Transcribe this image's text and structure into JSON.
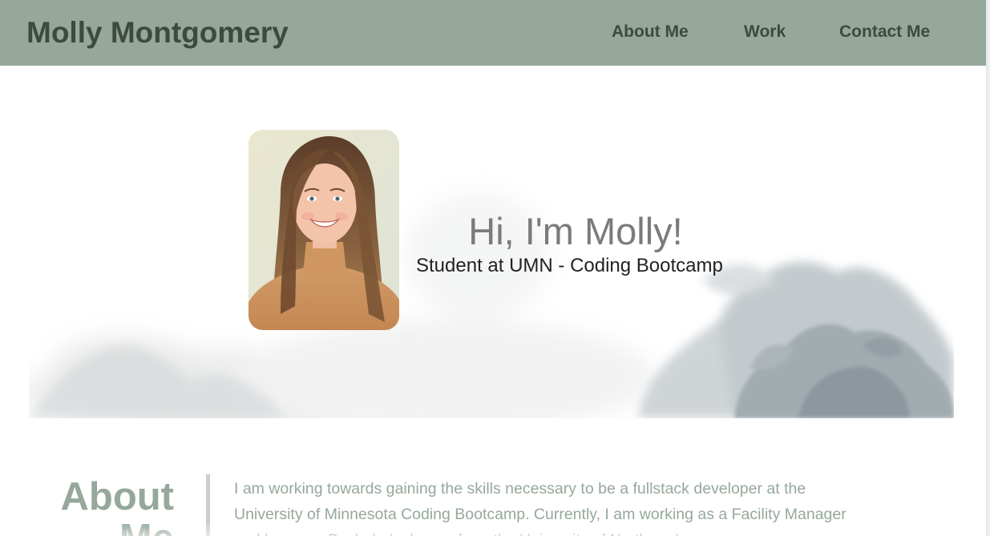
{
  "header": {
    "title": "Molly Montgomery",
    "nav": [
      {
        "label": "About Me"
      },
      {
        "label": "Work"
      },
      {
        "label": "Contact Me"
      }
    ],
    "background": "#96a89b",
    "text_color": "#3d4a3f"
  },
  "hero": {
    "heading": "Hi, I'm Molly!",
    "subheading": "Student at UMN - Coding Bootcamp",
    "portrait_icon": "profile-photo",
    "background_icon": "watercolor-splash"
  },
  "about": {
    "title": "About Me",
    "text": "I am working towards gaining the skills necessary to be a fullstack developer at the University of Minnesota Coding Bootcamp. Currently, I am working as a Facility Manager and have my Bachelor's degree from the University of Northern Iowa.",
    "accent": "#96a89b"
  }
}
